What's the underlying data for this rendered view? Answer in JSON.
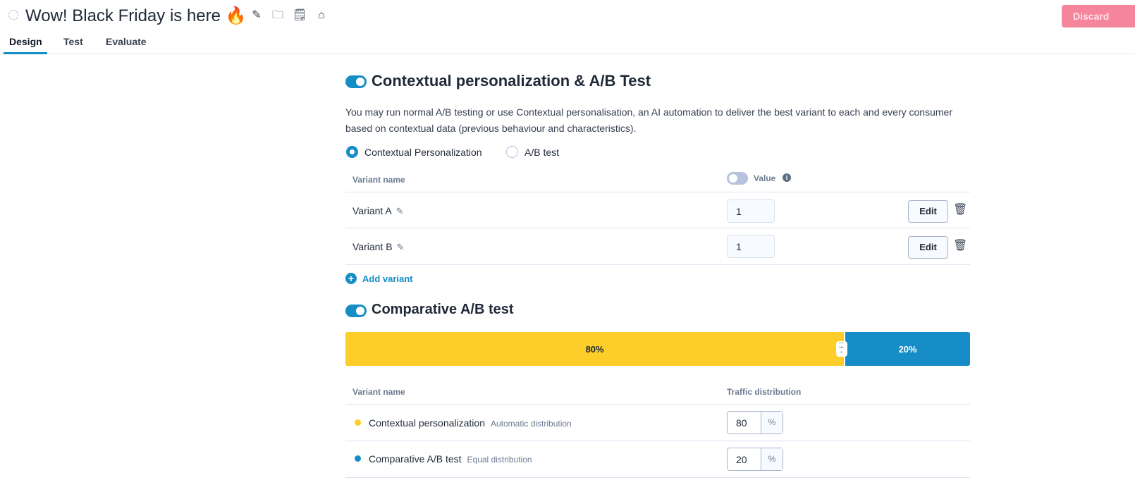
{
  "header": {
    "title": "Wow! Black Friday is here 🔥",
    "discard_label": "Discard"
  },
  "tabs": [
    {
      "label": "Design"
    },
    {
      "label": "Test"
    },
    {
      "label": "Evaluate"
    }
  ],
  "contextual": {
    "title": "Contextual personalization & A/B Test",
    "enabled": true,
    "description": "You may run normal A/B testing or use Contextual personalisation, an AI automation to deliver the best variant to each and every consumer based on contextual data (previous behaviour and characteristics).",
    "options": [
      {
        "label": "Contextual Personalization",
        "selected": true
      },
      {
        "label": "A/B test",
        "selected": false
      }
    ],
    "col_variant": "Variant name",
    "col_value": "Value",
    "variants": [
      {
        "name": "Variant A",
        "value": "1",
        "edit": "Edit"
      },
      {
        "name": "Variant B",
        "value": "1",
        "edit": "Edit"
      }
    ],
    "add_variant": "Add variant"
  },
  "comparative": {
    "title": "Comparative A/B test",
    "enabled": true,
    "split": [
      {
        "label": "80%",
        "value": 80,
        "color": "#fdce2a"
      },
      {
        "label": "20%",
        "value": 20,
        "color": "#168dc7"
      }
    ],
    "col_variant": "Variant name",
    "col_traffic": "Traffic distribution",
    "rows": [
      {
        "name": "Contextual personalization",
        "sub": "Automatic distribution",
        "value": "80",
        "unit": "%",
        "color": "#fdce2a"
      },
      {
        "name": "Comparative A/B test",
        "sub": "Equal distribution",
        "value": "20",
        "unit": "%",
        "color": "#168dc7"
      }
    ]
  }
}
